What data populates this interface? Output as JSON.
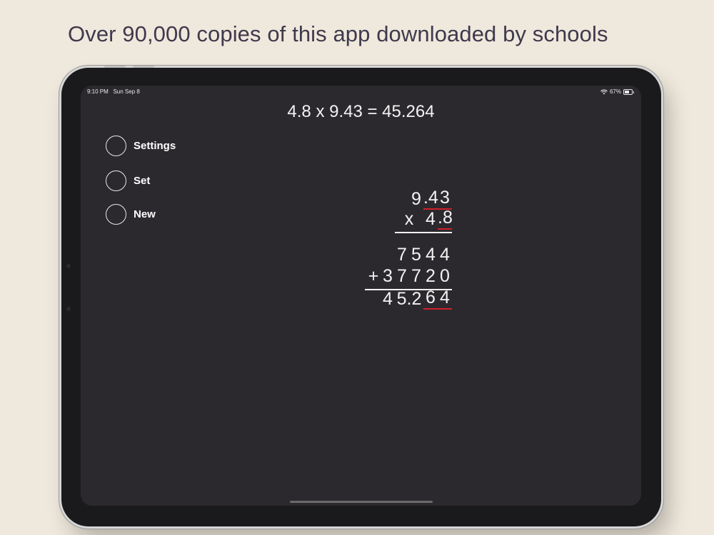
{
  "headline": "Over 90,000 copies of this app downloaded by schools",
  "status_bar": {
    "time": "9:10 PM",
    "date": "Sun Sep 8",
    "battery": "67%"
  },
  "equation": "4.8 x 9.43 = 45.264",
  "menu": {
    "items": [
      {
        "label": "Settings"
      },
      {
        "label": "Set"
      },
      {
        "label": "New"
      }
    ]
  },
  "multiplication": {
    "top": [
      "9",
      ".4",
      "3"
    ],
    "operator": "x",
    "bottom": [
      "4",
      ".8"
    ],
    "partial1": [
      "7",
      "5",
      "4",
      "4"
    ],
    "plus": "+",
    "partial2": [
      "3",
      "7",
      "7",
      "2",
      "0"
    ],
    "result": [
      "4",
      "5.2",
      "6",
      "4"
    ]
  },
  "colors": {
    "background": "#efe8dc",
    "screen": "#2c292e",
    "decimal_underline": "#d0202a"
  }
}
